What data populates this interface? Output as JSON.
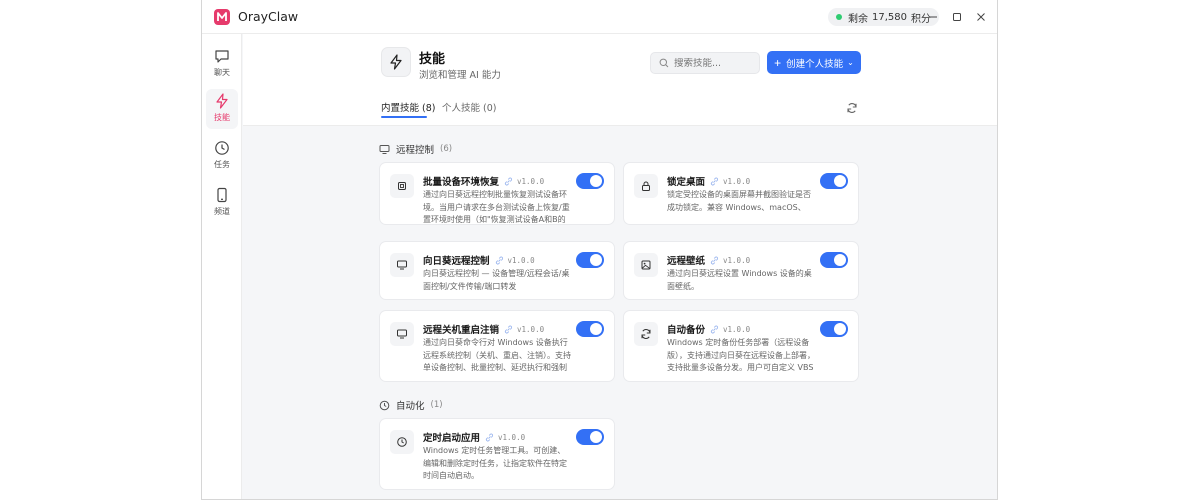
{
  "app": {
    "name": "OrayClaw"
  },
  "credits": {
    "label": "剩余",
    "value": "17,580",
    "unit": "积分"
  },
  "sidebar": {
    "items": [
      {
        "label": "聊天",
        "icon": "chat-icon"
      },
      {
        "label": "技能",
        "icon": "lightning-icon",
        "active": true
      },
      {
        "label": "任务",
        "icon": "clock-icon"
      },
      {
        "label": "频道",
        "icon": "phone-icon"
      }
    ]
  },
  "header": {
    "title": "技能",
    "subtitle": "浏览和管理 AI 能力",
    "search_placeholder": "搜索技能...",
    "create_label": "创建个人技能"
  },
  "tabs": [
    {
      "label": "内置技能 (8)",
      "active": true
    },
    {
      "label": "个人技能 (0)",
      "active": false
    }
  ],
  "sections": [
    {
      "title": "远程控制",
      "count": "(6)",
      "cards": [
        {
          "title": "批量设备环境恢复",
          "version": "v1.0.0",
          "desc": "通过向日葵远程控制批量恢复测试设备环境。当用户请求在多台测试设备上恢复/重置环境时使用（如\"恢复测试设备A和B的环...",
          "enabled": true
        },
        {
          "title": "锁定桌面",
          "version": "v1.0.0",
          "desc": "锁定受控设备的桌面屏幕并截图验证是否成功锁定。兼容 Windows、macOS、Linux。",
          "enabled": true
        },
        {
          "title": "向日葵远程控制",
          "version": "v1.0.0",
          "desc": "向日葵远程控制 — 设备管理/远程会话/桌面控制/文件传输/端口转发",
          "enabled": true
        },
        {
          "title": "远程壁纸",
          "version": "v1.0.0",
          "desc": "通过向日葵远程设置 Windows 设备的桌面壁纸。",
          "enabled": true
        },
        {
          "title": "远程关机重启注销",
          "version": "v1.0.0",
          "desc": "通过向日葵命令行对 Windows 设备执行远程系统控制（关机、重启、注销）。支持单设备控制、批量控制、延迟执行和强制模...",
          "enabled": true
        },
        {
          "title": "自动备份",
          "version": "v1.0.0",
          "desc": "Windows 定时备份任务部署（远程设备版），支持通过向日葵在远程设备上部署，支持批量多设备分发。用户可自定义 VBS ...",
          "enabled": true
        }
      ]
    },
    {
      "title": "自动化",
      "count": "(1)",
      "cards": [
        {
          "title": "定时启动应用",
          "version": "v1.0.0",
          "desc": "Windows 定时任务管理工具。可创建、编辑和删除定时任务，让指定软件在特定时间自动启动。",
          "enabled": true
        }
      ]
    }
  ],
  "colors": {
    "accent": "#3370f5",
    "brand": "#e63a6c",
    "status_dot": "#2ecc71"
  }
}
